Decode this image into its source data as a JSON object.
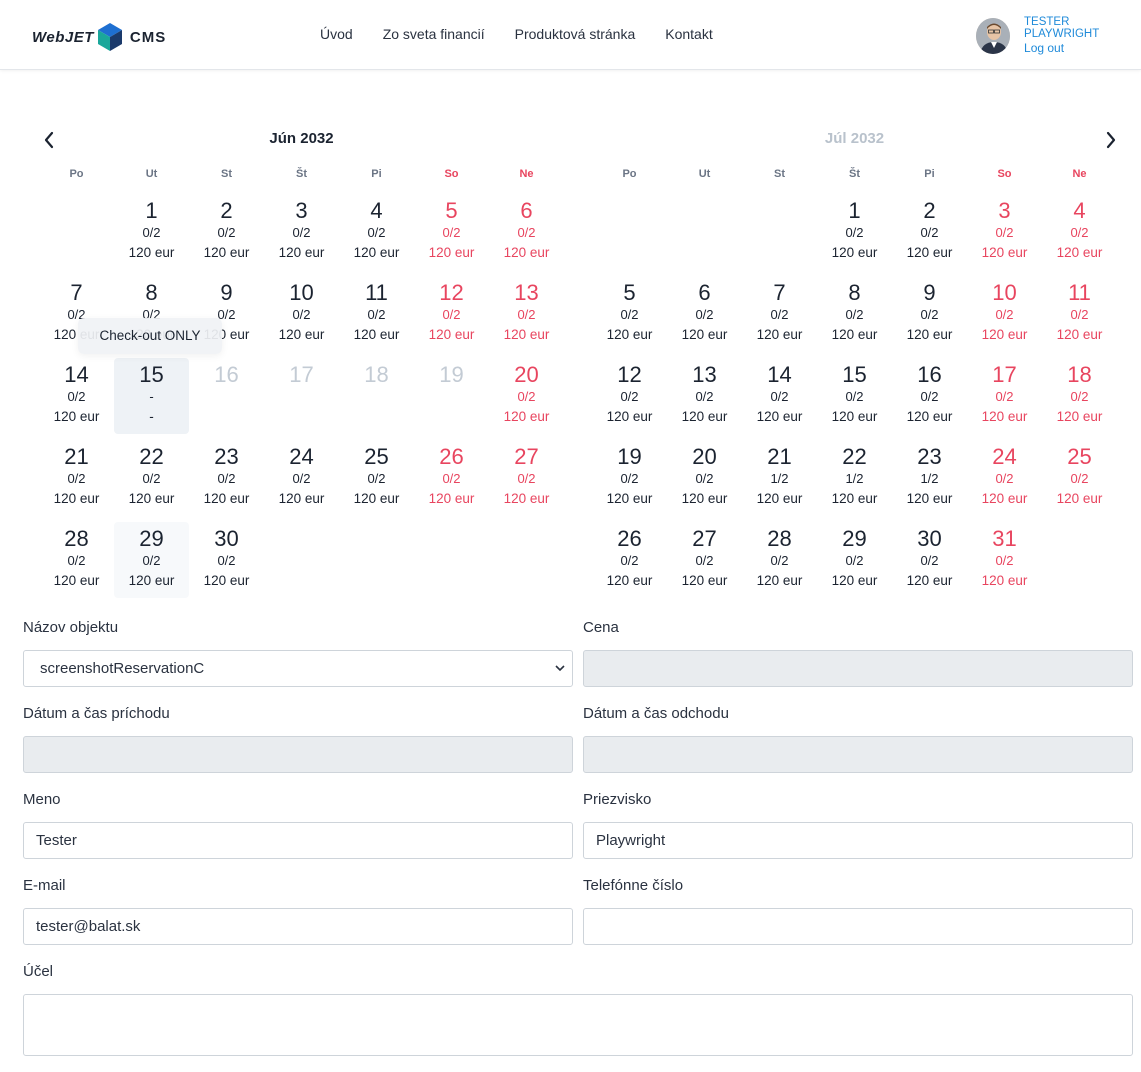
{
  "header": {
    "logo_left": "WebJET",
    "logo_right": "CMS",
    "nav": [
      "Úvod",
      "Zo sveta financií",
      "Produktová stránka",
      "Kontakt"
    ],
    "user_name": "TESTER PLAYWRIGHT",
    "logout": "Log out"
  },
  "calendar": {
    "weekdays": [
      "Po",
      "Ut",
      "St",
      "Št",
      "Pi",
      "So",
      "Ne"
    ],
    "left": {
      "title": "Jún  2032",
      "days": [
        {
          "n": "1",
          "occ": "0/2",
          "price": "120 eur"
        },
        {
          "n": "2",
          "occ": "0/2",
          "price": "120 eur"
        },
        {
          "n": "3",
          "occ": "0/2",
          "price": "120 eur"
        },
        {
          "n": "4",
          "occ": "0/2",
          "price": "120 eur"
        },
        {
          "n": "5",
          "occ": "0/2",
          "price": "120 eur"
        },
        {
          "n": "6",
          "occ": "0/2",
          "price": "120 eur"
        },
        {
          "n": "7",
          "occ": "0/2",
          "price": "120 eur"
        },
        {
          "n": "8",
          "occ": "0/2",
          "price": "120 eur"
        },
        {
          "n": "9",
          "occ": "0/2",
          "price": "120 eur"
        },
        {
          "n": "10",
          "occ": "0/2",
          "price": "120 eur"
        },
        {
          "n": "11",
          "occ": "0/2",
          "price": "120 eur"
        },
        {
          "n": "12",
          "occ": "0/2",
          "price": "120 eur"
        },
        {
          "n": "13",
          "occ": "0/2",
          "price": "120 eur"
        },
        {
          "n": "14",
          "occ": "0/2",
          "price": "120 eur"
        },
        {
          "n": "15",
          "occ": "-",
          "price": "-"
        },
        {
          "n": "16",
          "occ": "",
          "price": ""
        },
        {
          "n": "17",
          "occ": "",
          "price": ""
        },
        {
          "n": "18",
          "occ": "",
          "price": ""
        },
        {
          "n": "19",
          "occ": "",
          "price": ""
        },
        {
          "n": "20",
          "occ": "0/2",
          "price": "120 eur"
        },
        {
          "n": "21",
          "occ": "0/2",
          "price": "120 eur"
        },
        {
          "n": "22",
          "occ": "0/2",
          "price": "120 eur"
        },
        {
          "n": "23",
          "occ": "0/2",
          "price": "120 eur"
        },
        {
          "n": "24",
          "occ": "0/2",
          "price": "120 eur"
        },
        {
          "n": "25",
          "occ": "0/2",
          "price": "120 eur"
        },
        {
          "n": "26",
          "occ": "0/2",
          "price": "120 eur"
        },
        {
          "n": "27",
          "occ": "0/2",
          "price": "120 eur"
        },
        {
          "n": "28",
          "occ": "0/2",
          "price": "120 eur"
        },
        {
          "n": "29",
          "occ": "0/2",
          "price": "120 eur"
        },
        {
          "n": "30",
          "occ": "0/2",
          "price": "120 eur"
        }
      ],
      "tooltip": "Check-out ONLY"
    },
    "right": {
      "title": "Júl  2032",
      "days": [
        {
          "n": "1",
          "occ": "0/2",
          "price": "120 eur"
        },
        {
          "n": "2",
          "occ": "0/2",
          "price": "120 eur"
        },
        {
          "n": "3",
          "occ": "0/2",
          "price": "120 eur"
        },
        {
          "n": "4",
          "occ": "0/2",
          "price": "120 eur"
        },
        {
          "n": "5",
          "occ": "0/2",
          "price": "120 eur"
        },
        {
          "n": "6",
          "occ": "0/2",
          "price": "120 eur"
        },
        {
          "n": "7",
          "occ": "0/2",
          "price": "120 eur"
        },
        {
          "n": "8",
          "occ": "0/2",
          "price": "120 eur"
        },
        {
          "n": "9",
          "occ": "0/2",
          "price": "120 eur"
        },
        {
          "n": "10",
          "occ": "0/2",
          "price": "120 eur"
        },
        {
          "n": "11",
          "occ": "0/2",
          "price": "120 eur"
        },
        {
          "n": "12",
          "occ": "0/2",
          "price": "120 eur"
        },
        {
          "n": "13",
          "occ": "0/2",
          "price": "120 eur"
        },
        {
          "n": "14",
          "occ": "0/2",
          "price": "120 eur"
        },
        {
          "n": "15",
          "occ": "0/2",
          "price": "120 eur"
        },
        {
          "n": "16",
          "occ": "0/2",
          "price": "120 eur"
        },
        {
          "n": "17",
          "occ": "0/2",
          "price": "120 eur"
        },
        {
          "n": "18",
          "occ": "0/2",
          "price": "120 eur"
        },
        {
          "n": "19",
          "occ": "0/2",
          "price": "120 eur"
        },
        {
          "n": "20",
          "occ": "0/2",
          "price": "120 eur"
        },
        {
          "n": "21",
          "occ": "1/2",
          "price": "120 eur"
        },
        {
          "n": "22",
          "occ": "1/2",
          "price": "120 eur"
        },
        {
          "n": "23",
          "occ": "1/2",
          "price": "120 eur"
        },
        {
          "n": "24",
          "occ": "0/2",
          "price": "120 eur"
        },
        {
          "n": "25",
          "occ": "0/2",
          "price": "120 eur"
        },
        {
          "n": "26",
          "occ": "0/2",
          "price": "120 eur"
        },
        {
          "n": "27",
          "occ": "0/2",
          "price": "120 eur"
        },
        {
          "n": "28",
          "occ": "0/2",
          "price": "120 eur"
        },
        {
          "n": "29",
          "occ": "0/2",
          "price": "120 eur"
        },
        {
          "n": "30",
          "occ": "0/2",
          "price": "120 eur"
        },
        {
          "n": "31",
          "occ": "0/2",
          "price": "120 eur"
        }
      ]
    }
  },
  "form": {
    "object_label": "Názov objektu",
    "object_value": "screenshotReservationC",
    "price_label": "Cena",
    "price_value": "",
    "arrival_label": "Dátum a čas príchodu",
    "arrival_value": "",
    "departure_label": "Dátum a čas odchodu",
    "departure_value": "",
    "name_label": "Meno",
    "name_value": "Tester",
    "surname_label": "Priezvisko",
    "surname_value": "Playwright",
    "email_label": "E-mail",
    "email_value": "tester@balat.sk",
    "phone_label": "Telefónne číslo",
    "phone_value": "",
    "purpose_label": "Účel",
    "purpose_value": ""
  },
  "colors": {
    "weekend": "#e8455f",
    "link": "#1f8ad9",
    "disabled": "#c3cbd4"
  }
}
